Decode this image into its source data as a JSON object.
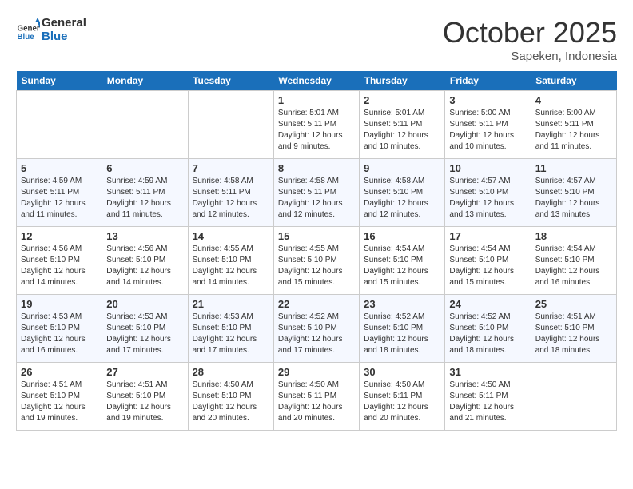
{
  "header": {
    "logo_line1": "General",
    "logo_line2": "Blue",
    "month": "October 2025",
    "location": "Sapeken, Indonesia"
  },
  "days_of_week": [
    "Sunday",
    "Monday",
    "Tuesday",
    "Wednesday",
    "Thursday",
    "Friday",
    "Saturday"
  ],
  "weeks": [
    [
      {
        "day": "",
        "info": ""
      },
      {
        "day": "",
        "info": ""
      },
      {
        "day": "",
        "info": ""
      },
      {
        "day": "1",
        "info": "Sunrise: 5:01 AM\nSunset: 5:11 PM\nDaylight: 12 hours and 9 minutes."
      },
      {
        "day": "2",
        "info": "Sunrise: 5:01 AM\nSunset: 5:11 PM\nDaylight: 12 hours and 10 minutes."
      },
      {
        "day": "3",
        "info": "Sunrise: 5:00 AM\nSunset: 5:11 PM\nDaylight: 12 hours and 10 minutes."
      },
      {
        "day": "4",
        "info": "Sunrise: 5:00 AM\nSunset: 5:11 PM\nDaylight: 12 hours and 11 minutes."
      }
    ],
    [
      {
        "day": "5",
        "info": "Sunrise: 4:59 AM\nSunset: 5:11 PM\nDaylight: 12 hours and 11 minutes."
      },
      {
        "day": "6",
        "info": "Sunrise: 4:59 AM\nSunset: 5:11 PM\nDaylight: 12 hours and 11 minutes."
      },
      {
        "day": "7",
        "info": "Sunrise: 4:58 AM\nSunset: 5:11 PM\nDaylight: 12 hours and 12 minutes."
      },
      {
        "day": "8",
        "info": "Sunrise: 4:58 AM\nSunset: 5:11 PM\nDaylight: 12 hours and 12 minutes."
      },
      {
        "day": "9",
        "info": "Sunrise: 4:58 AM\nSunset: 5:10 PM\nDaylight: 12 hours and 12 minutes."
      },
      {
        "day": "10",
        "info": "Sunrise: 4:57 AM\nSunset: 5:10 PM\nDaylight: 12 hours and 13 minutes."
      },
      {
        "day": "11",
        "info": "Sunrise: 4:57 AM\nSunset: 5:10 PM\nDaylight: 12 hours and 13 minutes."
      }
    ],
    [
      {
        "day": "12",
        "info": "Sunrise: 4:56 AM\nSunset: 5:10 PM\nDaylight: 12 hours and 14 minutes."
      },
      {
        "day": "13",
        "info": "Sunrise: 4:56 AM\nSunset: 5:10 PM\nDaylight: 12 hours and 14 minutes."
      },
      {
        "day": "14",
        "info": "Sunrise: 4:55 AM\nSunset: 5:10 PM\nDaylight: 12 hours and 14 minutes."
      },
      {
        "day": "15",
        "info": "Sunrise: 4:55 AM\nSunset: 5:10 PM\nDaylight: 12 hours and 15 minutes."
      },
      {
        "day": "16",
        "info": "Sunrise: 4:54 AM\nSunset: 5:10 PM\nDaylight: 12 hours and 15 minutes."
      },
      {
        "day": "17",
        "info": "Sunrise: 4:54 AM\nSunset: 5:10 PM\nDaylight: 12 hours and 15 minutes."
      },
      {
        "day": "18",
        "info": "Sunrise: 4:54 AM\nSunset: 5:10 PM\nDaylight: 12 hours and 16 minutes."
      }
    ],
    [
      {
        "day": "19",
        "info": "Sunrise: 4:53 AM\nSunset: 5:10 PM\nDaylight: 12 hours and 16 minutes."
      },
      {
        "day": "20",
        "info": "Sunrise: 4:53 AM\nSunset: 5:10 PM\nDaylight: 12 hours and 17 minutes."
      },
      {
        "day": "21",
        "info": "Sunrise: 4:53 AM\nSunset: 5:10 PM\nDaylight: 12 hours and 17 minutes."
      },
      {
        "day": "22",
        "info": "Sunrise: 4:52 AM\nSunset: 5:10 PM\nDaylight: 12 hours and 17 minutes."
      },
      {
        "day": "23",
        "info": "Sunrise: 4:52 AM\nSunset: 5:10 PM\nDaylight: 12 hours and 18 minutes."
      },
      {
        "day": "24",
        "info": "Sunrise: 4:52 AM\nSunset: 5:10 PM\nDaylight: 12 hours and 18 minutes."
      },
      {
        "day": "25",
        "info": "Sunrise: 4:51 AM\nSunset: 5:10 PM\nDaylight: 12 hours and 18 minutes."
      }
    ],
    [
      {
        "day": "26",
        "info": "Sunrise: 4:51 AM\nSunset: 5:10 PM\nDaylight: 12 hours and 19 minutes."
      },
      {
        "day": "27",
        "info": "Sunrise: 4:51 AM\nSunset: 5:10 PM\nDaylight: 12 hours and 19 minutes."
      },
      {
        "day": "28",
        "info": "Sunrise: 4:50 AM\nSunset: 5:10 PM\nDaylight: 12 hours and 20 minutes."
      },
      {
        "day": "29",
        "info": "Sunrise: 4:50 AM\nSunset: 5:11 PM\nDaylight: 12 hours and 20 minutes."
      },
      {
        "day": "30",
        "info": "Sunrise: 4:50 AM\nSunset: 5:11 PM\nDaylight: 12 hours and 20 minutes."
      },
      {
        "day": "31",
        "info": "Sunrise: 4:50 AM\nSunset: 5:11 PM\nDaylight: 12 hours and 21 minutes."
      },
      {
        "day": "",
        "info": ""
      }
    ]
  ]
}
